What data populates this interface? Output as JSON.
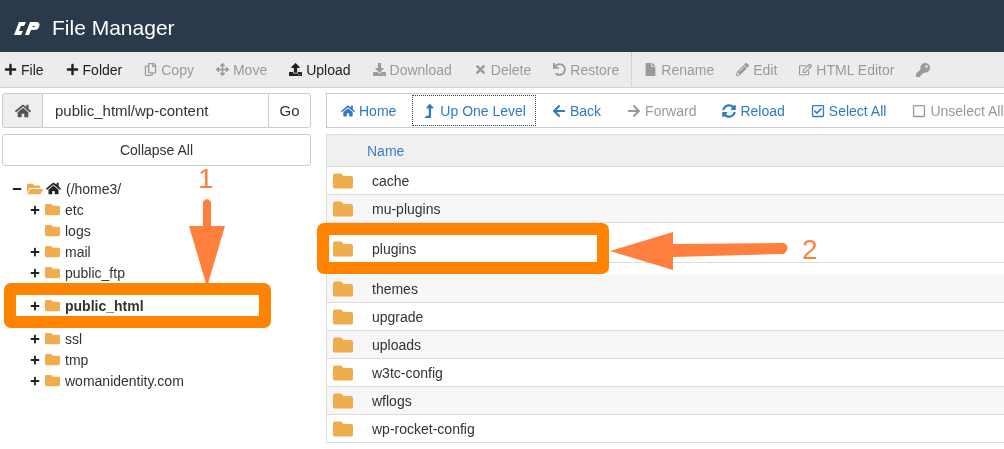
{
  "header": {
    "title": "File Manager"
  },
  "toolbar": [
    {
      "label": "File",
      "disabled": false
    },
    {
      "label": "Folder",
      "disabled": false
    },
    {
      "label": "Copy",
      "disabled": true
    },
    {
      "label": "Move",
      "disabled": true
    },
    {
      "label": "Upload",
      "disabled": false
    },
    {
      "label": "Download",
      "disabled": true
    },
    {
      "label": "Delete",
      "disabled": true
    },
    {
      "label": "Restore",
      "disabled": true
    },
    {
      "label": "Rename",
      "disabled": true
    },
    {
      "label": "Edit",
      "disabled": true
    },
    {
      "label": "HTML Editor",
      "disabled": true
    }
  ],
  "path_bar": {
    "value": "public_html/wp-content",
    "go": "Go"
  },
  "collapse_all": "Collapse All",
  "tree": [
    {
      "label": "(/home3/",
      "expanded": true,
      "selected": false,
      "highlighted": false,
      "children": [
        {
          "label": "etc",
          "expandable": true,
          "selected": false,
          "highlighted": false
        },
        {
          "label": "logs",
          "expandable": false,
          "selected": false,
          "highlighted": false
        },
        {
          "label": "mail",
          "expandable": true,
          "selected": false,
          "highlighted": false
        },
        {
          "label": "public_ftp",
          "expandable": true,
          "selected": false,
          "highlighted": false
        },
        {
          "label": "public_html",
          "expandable": true,
          "selected": true,
          "highlighted": true
        },
        {
          "label": "ssl",
          "expandable": true,
          "selected": false,
          "highlighted": false
        },
        {
          "label": "tmp",
          "expandable": true,
          "selected": false,
          "highlighted": false
        },
        {
          "label": "womanidentity.com",
          "expandable": true,
          "selected": false,
          "highlighted": false
        }
      ]
    }
  ],
  "nav": [
    {
      "label": "Home",
      "disabled": false,
      "focused": false
    },
    {
      "label": "Up One Level",
      "disabled": false,
      "focused": true
    },
    {
      "label": "Back",
      "disabled": false,
      "focused": false
    },
    {
      "label": "Forward",
      "disabled": true,
      "focused": false
    },
    {
      "label": "Reload",
      "disabled": false,
      "focused": false
    },
    {
      "label": "Select All",
      "disabled": false,
      "focused": false
    },
    {
      "label": "Unselect All",
      "disabled": true,
      "focused": false
    }
  ],
  "table": {
    "columns": [
      "Name"
    ],
    "rows": [
      {
        "name": "cache",
        "highlighted": false
      },
      {
        "name": "mu-plugins",
        "highlighted": false
      },
      {
        "name": "plugins",
        "highlighted": true
      },
      {
        "name": "themes",
        "highlighted": false
      },
      {
        "name": "upgrade",
        "highlighted": false
      },
      {
        "name": "uploads",
        "highlighted": false
      },
      {
        "name": "w3tc-config",
        "highlighted": false
      },
      {
        "name": "wflogs",
        "highlighted": false
      },
      {
        "name": "wp-rocket-config",
        "highlighted": false
      }
    ]
  },
  "annotations": [
    {
      "label": "1"
    },
    {
      "label": "2"
    }
  ]
}
